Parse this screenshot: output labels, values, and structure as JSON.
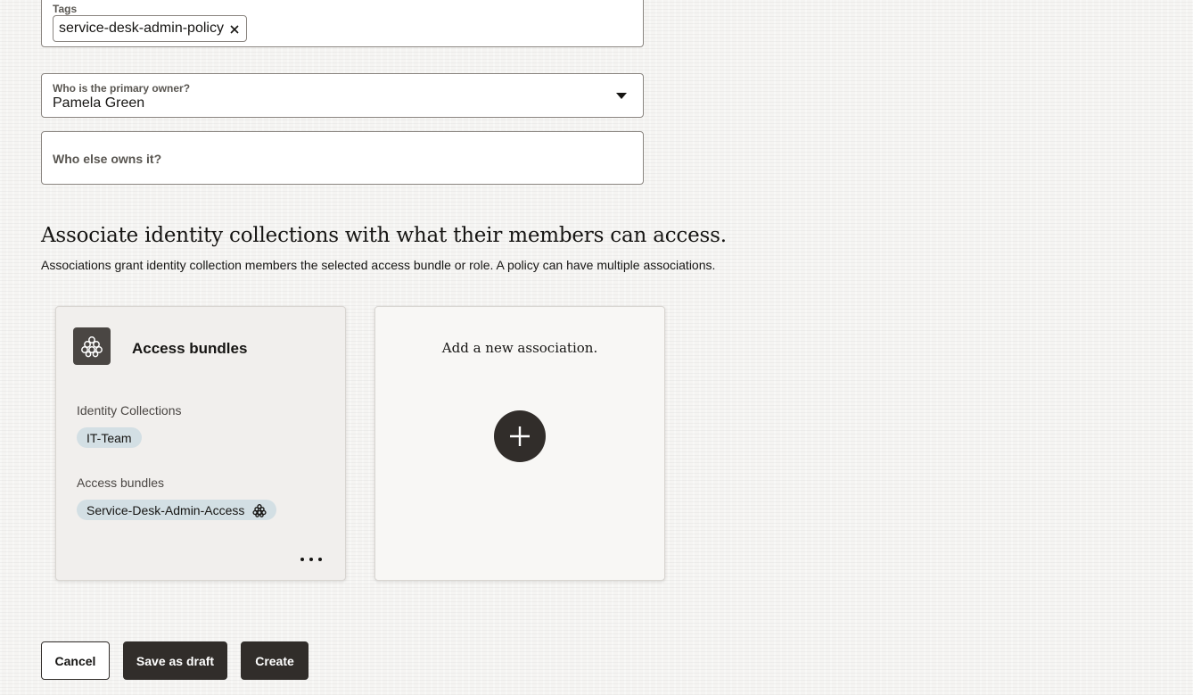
{
  "tags": {
    "label": "Tags",
    "chips": [
      {
        "value": "service-desk-admin-policy",
        "remove_icon": "close-icon"
      }
    ]
  },
  "primary_owner": {
    "label": "Who is the primary owner?",
    "value": "Pamela Green",
    "icon": "caret-down-icon"
  },
  "other_owners": {
    "label": "Who else owns it?"
  },
  "associations": {
    "heading": "Associate identity collections with what their members can access.",
    "description": "Associations grant identity collection members the selected access bundle or role. A policy can have multiple associations.",
    "card": {
      "icon": "access-bundle-icon",
      "title": "Access bundles",
      "identity_label": "Identity Collections",
      "identity_collections": [
        "IT-Team"
      ],
      "bundle_label": "Access bundles",
      "access_bundles": [
        "Service-Desk-Admin-Access"
      ],
      "bundle_icon": "access-bundle-icon",
      "menu_icon": "more-actions-icon"
    },
    "new_card": {
      "title": "Add a new association.",
      "icon": "plus-icon"
    }
  },
  "actions": {
    "cancel": "Cancel",
    "save_draft": "Save as draft",
    "create": "Create"
  },
  "colors": {
    "primary_button": "#312d2a",
    "chip_background": "#d3dfe4",
    "icon_tile": "#4a4643"
  }
}
